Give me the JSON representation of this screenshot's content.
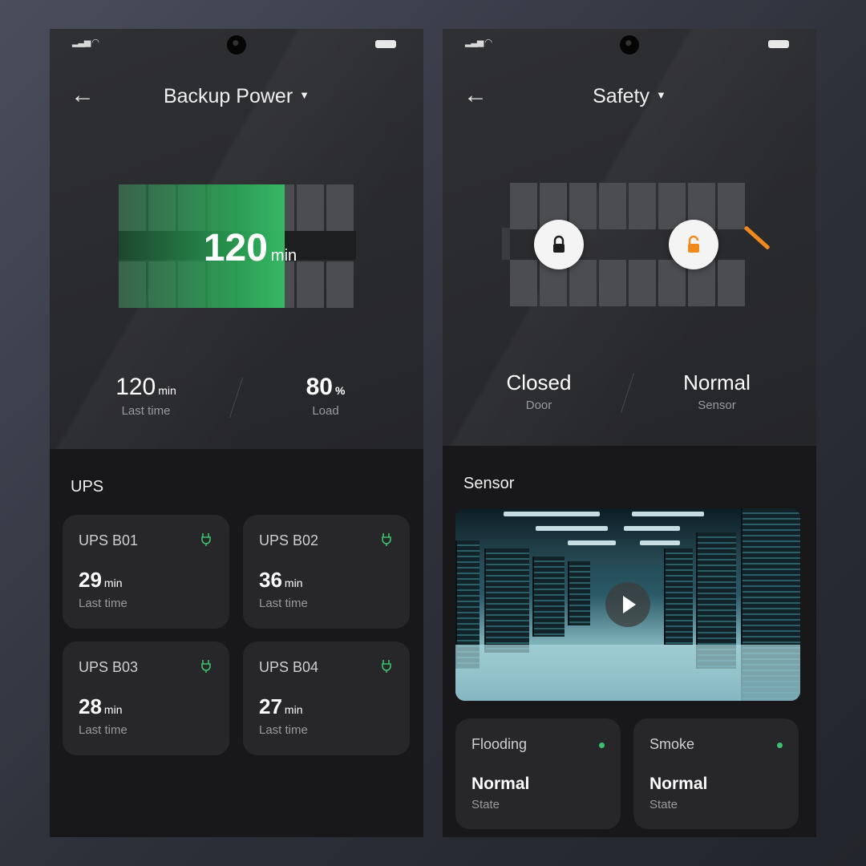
{
  "left": {
    "title": "Backup Power",
    "gauge": {
      "value": "120",
      "unit": "min",
      "fill_fraction": 0.7
    },
    "stats": [
      {
        "value": "120",
        "unit": "min",
        "label": "Last time"
      },
      {
        "value": "80",
        "unit": "%",
        "label": "Load"
      }
    ],
    "section_title": "UPS",
    "ups": [
      {
        "name": "UPS B01",
        "value": "29",
        "unit": "min",
        "label": "Last time"
      },
      {
        "name": "UPS B02",
        "value": "36",
        "unit": "min",
        "label": "Last time"
      },
      {
        "name": "UPS B03",
        "value": "28",
        "unit": "min",
        "label": "Last time"
      },
      {
        "name": "UPS B04",
        "value": "27",
        "unit": "min",
        "label": "Last time"
      }
    ]
  },
  "right": {
    "title": "Safety",
    "stats": [
      {
        "value": "Closed",
        "label": "Door"
      },
      {
        "value": "Normal",
        "label": "Sensor"
      }
    ],
    "section_title": "Sensor",
    "sensors": [
      {
        "name": "Flooding",
        "value": "Normal",
        "label": "State"
      },
      {
        "name": "Smoke",
        "value": "Normal",
        "label": "State"
      }
    ]
  },
  "colors": {
    "accent_green": "#36b865",
    "lock_open": "#f08a1c",
    "status_dot": "#3cc06d"
  },
  "icons": [
    "signal-icon",
    "wifi-icon",
    "battery-icon",
    "back-arrow-icon",
    "caret-down-icon",
    "plug-icon",
    "lock-closed-icon",
    "lock-open-icon",
    "play-icon",
    "status-dot-icon"
  ]
}
